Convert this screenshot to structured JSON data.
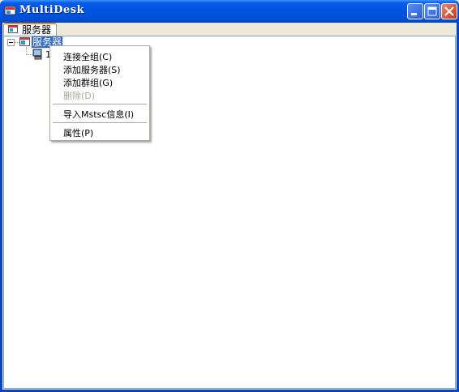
{
  "window": {
    "title": "MultiDesk"
  },
  "tabs": [
    {
      "label": "服务器"
    }
  ],
  "tree": {
    "root_label": "服务器",
    "child_label": "1"
  },
  "context_menu": {
    "items": [
      {
        "label": "连接全组(C)",
        "enabled": true
      },
      {
        "label": "添加服务器(S)",
        "enabled": true
      },
      {
        "label": "添加群组(G)",
        "enabled": true
      },
      {
        "label": "删除(D)",
        "enabled": false
      },
      {
        "label": "导入Mstsc信息(I)",
        "enabled": true
      },
      {
        "label": "属性(P)",
        "enabled": true
      }
    ]
  },
  "colors": {
    "titlebar": "#0054E3",
    "selection": "#316AC5",
    "tab_accent": "#E68B2C"
  }
}
